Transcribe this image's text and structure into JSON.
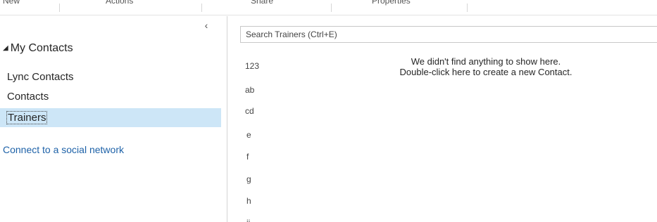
{
  "ribbon": {
    "groups": [
      "New",
      "Actions",
      "Share",
      "Properties"
    ]
  },
  "folder_pane": {
    "collapse_glyph": "‹",
    "group_header": "My Contacts",
    "items": [
      {
        "label": "Lync Contacts",
        "selected": false
      },
      {
        "label": "Contacts",
        "selected": false
      },
      {
        "label": "Trainers",
        "selected": true
      }
    ],
    "social_link": "Connect to a social network"
  },
  "contacts_view": {
    "search_placeholder": "Search Trainers (Ctrl+E)",
    "index": [
      "123",
      "ab",
      "cd",
      "e",
      "f",
      "g",
      "h",
      "ij"
    ],
    "empty_line1": "We didn't find anything to show here.",
    "empty_line2": "Double-click here to create a new Contact."
  },
  "colors": {
    "selected_bg": "#cde6f7",
    "link": "#1e62a8"
  }
}
